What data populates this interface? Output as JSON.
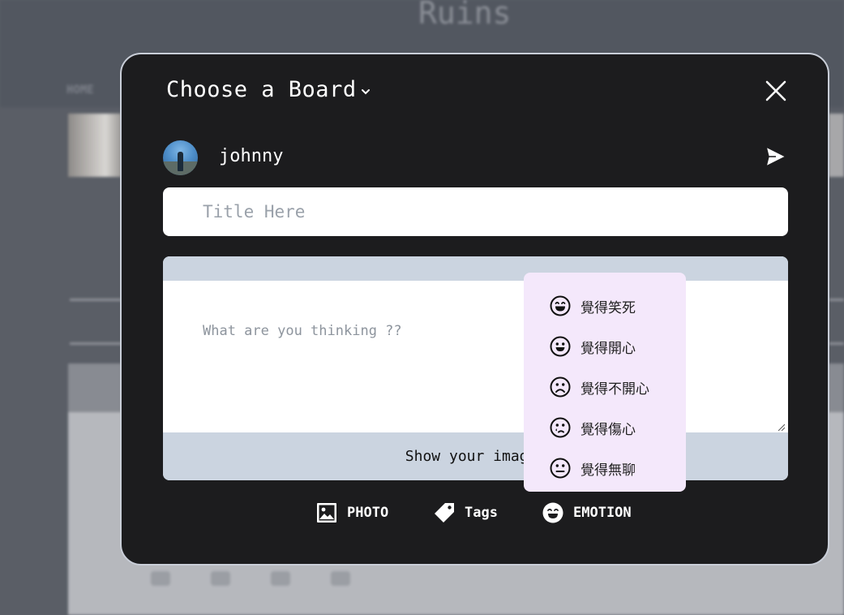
{
  "background": {
    "logo": "Ruins",
    "nav_home": "HOME"
  },
  "modal": {
    "board_selector": "Choose a Board",
    "user": {
      "name": "johnny"
    },
    "title_placeholder": "Title Here",
    "content_placeholder": "What are you thinking ??",
    "upload_label": "Show your images",
    "actions": [
      {
        "label": "PHOTO",
        "icon": "image-icon"
      },
      {
        "label": "Tags",
        "icon": "tag-icon"
      },
      {
        "label": "EMOTION",
        "icon": "laughing-face-icon"
      }
    ]
  },
  "emotion_menu": {
    "items": [
      {
        "label": "覺得笑死",
        "icon": "laughing-face-icon"
      },
      {
        "label": "覺得開心",
        "icon": "smiling-face-icon"
      },
      {
        "label": "覺得不開心",
        "icon": "frowning-face-icon"
      },
      {
        "label": "覺得傷心",
        "icon": "sad-tear-face-icon"
      },
      {
        "label": "覺得無聊",
        "icon": "neutral-face-icon"
      }
    ]
  },
  "colors": {
    "modal_bg": "#1c1c1e",
    "modal_border": "#c9ced8",
    "editor_bar": "#cbd4e0",
    "emotion_menu_bg": "#f4e8fb"
  }
}
